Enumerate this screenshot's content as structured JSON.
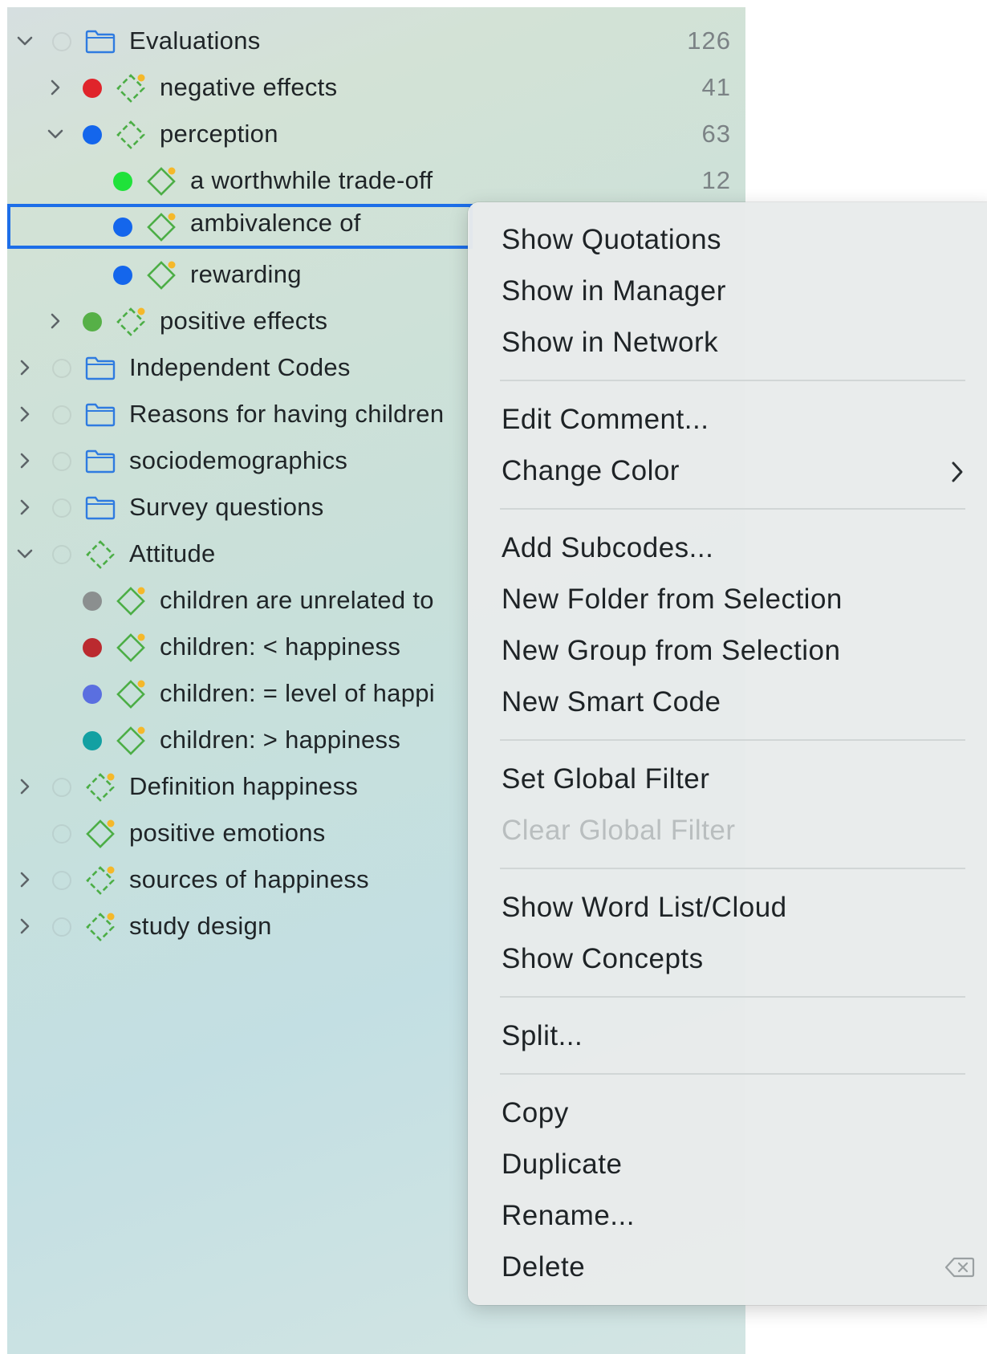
{
  "tree": {
    "rows": [
      {
        "label": "Evaluations",
        "count": "126"
      },
      {
        "label": "negative effects",
        "count": "41"
      },
      {
        "label": "perception",
        "count": "63"
      },
      {
        "label": "a worthwhile trade-off",
        "count": "12"
      },
      {
        "label": "ambivalence of"
      },
      {
        "label": "rewarding"
      },
      {
        "label": "positive effects"
      },
      {
        "label": "Independent Codes"
      },
      {
        "label": "Reasons for having children"
      },
      {
        "label": "sociodemographics"
      },
      {
        "label": "Survey questions"
      },
      {
        "label": "Attitude"
      },
      {
        "label": "children are unrelated to"
      },
      {
        "label": "children: < happiness"
      },
      {
        "label": "children: = level of happi"
      },
      {
        "label": "children: > happiness"
      },
      {
        "label": "Definition happiness"
      },
      {
        "label": "positive emotions"
      },
      {
        "label": "sources of happiness"
      },
      {
        "label": "study design"
      }
    ],
    "colors": {
      "red": "#e0242b",
      "blue": "#1466ec",
      "green_bright": "#1fe23a",
      "green": "#56b047",
      "gray": "#8b8f8f",
      "dark_red": "#bb2a2f",
      "periwinkle": "#5a6fe0",
      "teal": "#13a0a2",
      "selection": "#1d6ee8"
    }
  },
  "context_menu": {
    "items": [
      {
        "label": "Show Quotations"
      },
      {
        "label": "Show in Manager"
      },
      {
        "label": "Show in Network"
      },
      {
        "label": "Edit Comment..."
      },
      {
        "label": "Change Color",
        "submenu_icon": "chevron-right-icon"
      },
      {
        "label": "Add Subcodes..."
      },
      {
        "label": "New Folder from Selection"
      },
      {
        "label": "New Group from Selection"
      },
      {
        "label": "New Smart Code"
      },
      {
        "label": "Set Global Filter"
      },
      {
        "label": "Clear Global Filter",
        "disabled": true
      },
      {
        "label": "Show Word List/Cloud"
      },
      {
        "label": "Show Concepts"
      },
      {
        "label": "Split..."
      },
      {
        "label": "Copy"
      },
      {
        "label": "Duplicate"
      },
      {
        "label": "Rename..."
      },
      {
        "label": "Delete",
        "shortcut_icon": "delete-key-icon"
      }
    ]
  }
}
